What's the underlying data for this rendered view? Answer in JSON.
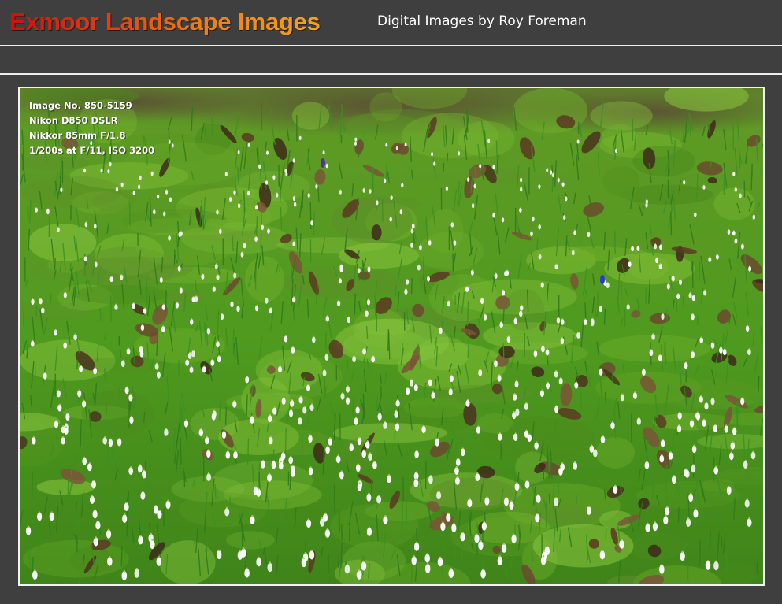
{
  "header": {
    "site_title": "Exmoor Landscape Images",
    "tagline": "Digital Images by Roy Foreman"
  },
  "photo": {
    "subject_icon": "snowdrops-photo",
    "exif": {
      "image_no": "Image No. 850-5159",
      "camera": "Nikon D850 DSLR",
      "lens": "Nikkor 85mm F/1.8",
      "exposure": "1/200s at F/11, ISO 3200"
    }
  },
  "colors": {
    "background": "#3f3f3f",
    "rule": "#ececec",
    "title_gradient_start": "#d40d0d",
    "title_gradient_end": "#f4a51c"
  }
}
